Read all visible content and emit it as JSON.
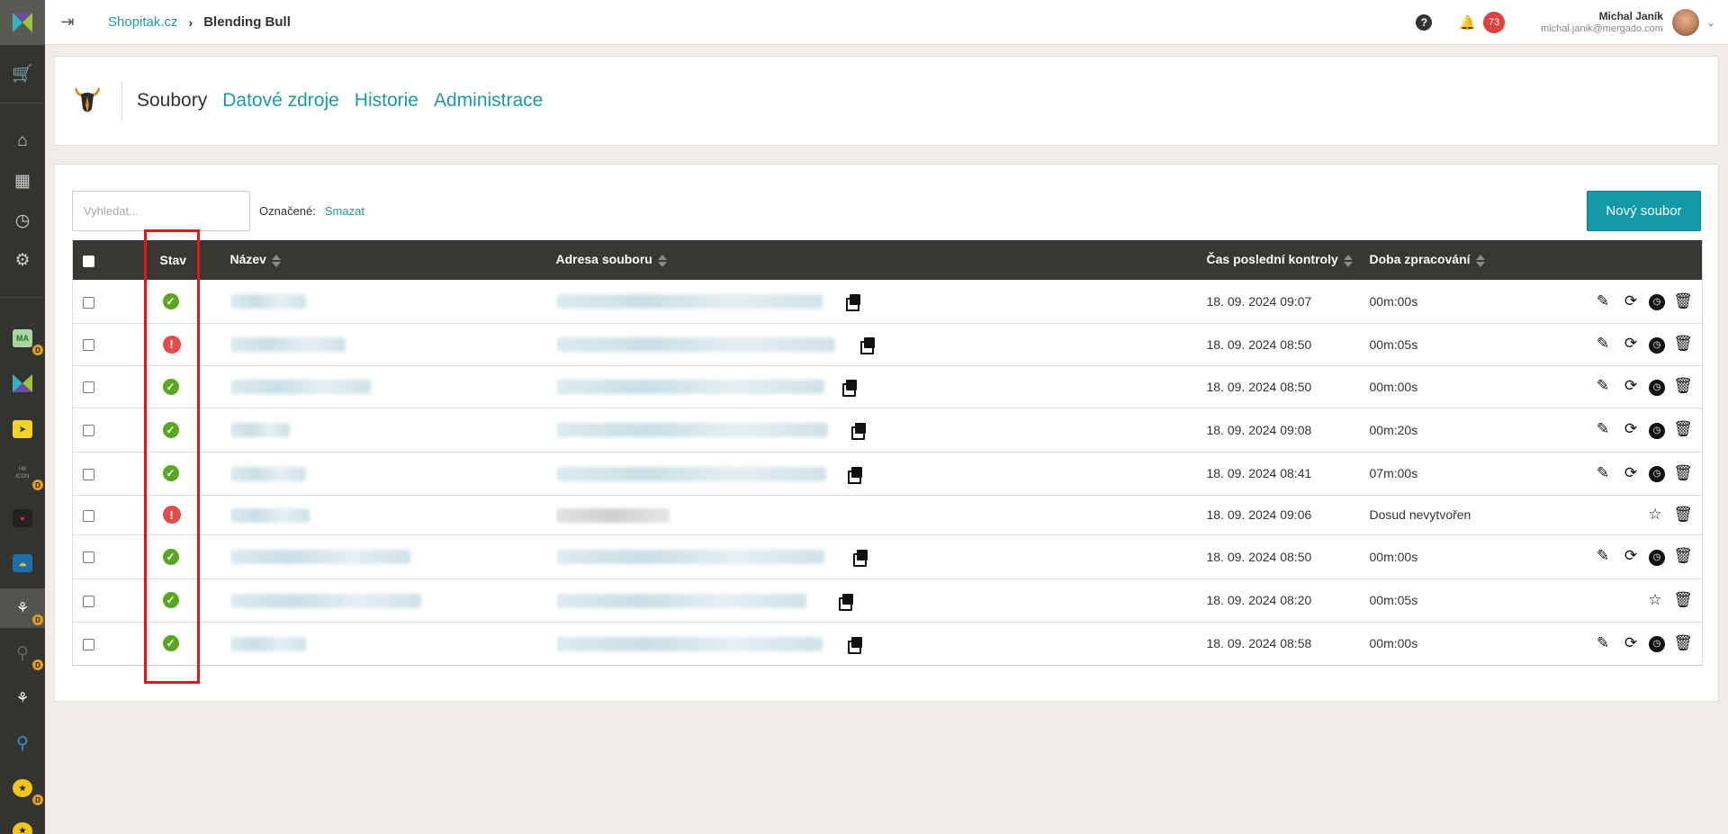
{
  "topbar": {
    "breadcrumb_link": "Shopitak.cz",
    "breadcrumb_current": "Blending Bull",
    "notification_count": "73",
    "user_name": "Michal Janík",
    "user_email": "michal.janik@mergado.com"
  },
  "rail": {
    "icons": [
      "mergado-logo",
      "cart-icon",
      "home-icon",
      "grid-icon",
      "clock-icon",
      "gear-icon",
      "app-ma",
      "app-mergado",
      "app-pin",
      "app-hb",
      "app-dark",
      "app-cloud",
      "app-bull",
      "app-key",
      "app-bull-2",
      "app-key-2",
      "app-yellow",
      "app-yellow-2"
    ],
    "tile_ma": "MA",
    "tile_hb": "HB ICON",
    "badge": "D"
  },
  "module": {
    "tabs": [
      {
        "label": "Soubory",
        "active": true
      },
      {
        "label": "Datové zdroje",
        "active": false
      },
      {
        "label": "Historie",
        "active": false
      },
      {
        "label": "Administrace",
        "active": false
      }
    ]
  },
  "toolbar": {
    "search_placeholder": "Vyhledat...",
    "marked_label": "Označené:",
    "delete_label": "Smazat",
    "new_file_label": "Nový soubor"
  },
  "table": {
    "columns": [
      "Stav",
      "Název",
      "Adresa souboru",
      "Čas poslední kontroly",
      "Doba zpracování"
    ],
    "rows": [
      {
        "status": "ok",
        "time": "18. 09. 2024 09:07",
        "duration": "00m:00s",
        "actions": "full"
      },
      {
        "status": "error",
        "time": "18. 09. 2024 08:50",
        "duration": "00m:05s",
        "actions": "full"
      },
      {
        "status": "ok",
        "time": "18. 09. 2024 08:50",
        "duration": "00m:00s",
        "actions": "full"
      },
      {
        "status": "ok",
        "time": "18. 09. 2024 09:08",
        "duration": "00m:20s",
        "actions": "full"
      },
      {
        "status": "ok",
        "time": "18. 09. 2024 08:41",
        "duration": "07m:00s",
        "actions": "full"
      },
      {
        "status": "error",
        "time": "18. 09. 2024 09:06",
        "duration": "Dosud nevytvořen",
        "actions": "wand"
      },
      {
        "status": "ok",
        "time": "18. 09. 2024 08:50",
        "duration": "00m:00s",
        "actions": "full"
      },
      {
        "status": "ok",
        "time": "18. 09. 2024 08:20",
        "duration": "00m:05s",
        "actions": "wand"
      },
      {
        "status": "ok",
        "time": "18. 09. 2024 08:58",
        "duration": "00m:00s",
        "actions": "full"
      }
    ]
  },
  "colors": {
    "accent": "#1b9aaa",
    "button": "#139aa8",
    "table_header": "#373733",
    "status_ok": "#5aa71f",
    "status_error": "#e14d4d",
    "highlight": "#e81515"
  }
}
